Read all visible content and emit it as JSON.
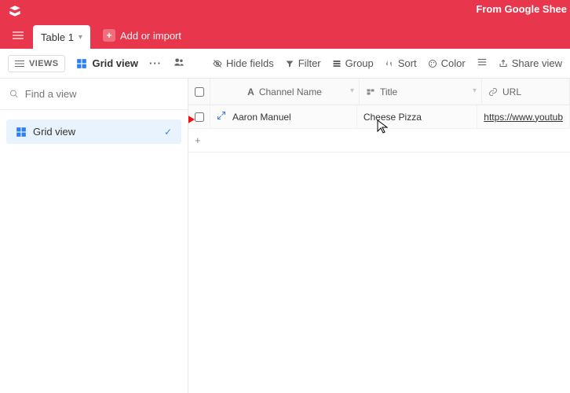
{
  "header": {
    "app_title": "From Google Shee"
  },
  "tabs": {
    "table1": "Table 1",
    "add_or_import": "Add or import"
  },
  "toolbar": {
    "views_label": "VIEWS",
    "view_name": "Grid view",
    "hide_fields": "Hide fields",
    "filter": "Filter",
    "group": "Group",
    "sort": "Sort",
    "color": "Color",
    "share": "Share view"
  },
  "sidebar": {
    "find_placeholder": "Find a view",
    "grid_view_label": "Grid view"
  },
  "columns": {
    "channel_name": "Channel Name",
    "title": "Title",
    "url": "URL"
  },
  "rows": [
    {
      "channel_name": "Aaron Manuel",
      "title": "Cheese Pizza",
      "url": "https://www.youtub"
    }
  ],
  "addrow": "+"
}
